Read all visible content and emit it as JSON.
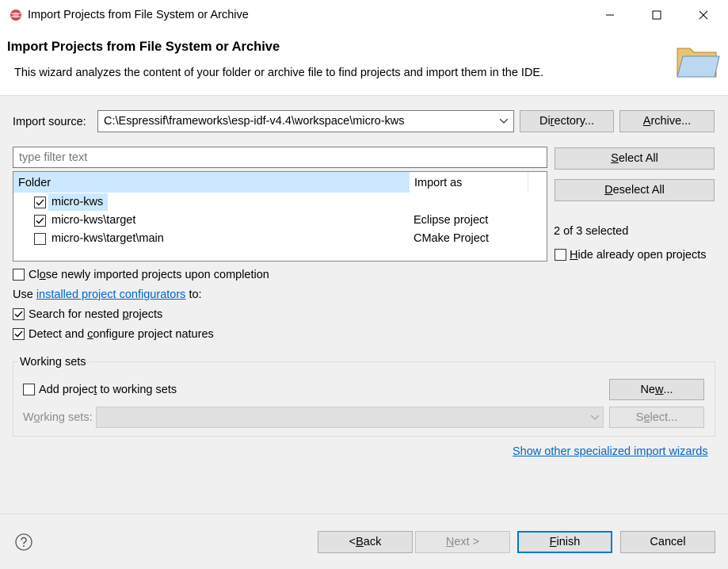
{
  "window": {
    "title": "Import Projects from File System or Archive"
  },
  "header": {
    "title": "Import Projects from File System or Archive",
    "description": "This wizard analyzes the content of your folder or archive file to find projects and import them in the IDE."
  },
  "import_source": {
    "label": "Import source:",
    "value": "C:\\Espressif\\frameworks\\esp-idf-v4.4\\workspace\\micro-kws",
    "directory_btn": {
      "pre": "Di",
      "u": "r",
      "post": "ectory..."
    },
    "archive_btn": {
      "pre": "",
      "u": "A",
      "post": "rchive..."
    }
  },
  "filter": {
    "placeholder": "type filter text"
  },
  "table": {
    "col_folder": "Folder",
    "col_import_as": "Import as",
    "rows": [
      {
        "folder": "micro-kws",
        "import_as": "",
        "checked": true
      },
      {
        "folder": "micro-kws\\target",
        "import_as": "Eclipse project",
        "checked": true
      },
      {
        "folder": "micro-kws\\target\\main",
        "import_as": "CMake Project",
        "checked": false
      }
    ]
  },
  "side": {
    "select_all": {
      "pre": "",
      "u": "S",
      "post": "elect All"
    },
    "deselect_all": {
      "pre": "",
      "u": "D",
      "post": "eselect All"
    },
    "selected_count": "2 of 3 selected",
    "hide_open": {
      "pre": "",
      "u": "H",
      "post": "ide already open projects"
    }
  },
  "options": {
    "close_projects": {
      "pre": "Cl",
      "u": "o",
      "post": "se newly imported projects upon completion"
    },
    "use_prefix": "Use",
    "configurators_link": "installed project configurators",
    "use_suffix": "to:",
    "search_nested": {
      "pre": "Search for nested ",
      "u": "p",
      "post": "rojects"
    },
    "detect_natures": {
      "pre": "Detect and ",
      "u": "c",
      "post": "onfigure project natures"
    }
  },
  "working_sets": {
    "group_label": "Working sets",
    "add_label": {
      "pre": "Add projec",
      "u": "t",
      "post": " to working sets"
    },
    "new_btn": {
      "pre": "Ne",
      "u": "w",
      "post": "..."
    },
    "field_label": {
      "pre": "W",
      "u": "o",
      "post": "rking sets:"
    },
    "select_btn": {
      "pre": "S",
      "u": "e",
      "post": "lect..."
    }
  },
  "specialized_link": "Show other specialized import wizards",
  "footer": {
    "back": {
      "pre": "< ",
      "u": "B",
      "post": "ack"
    },
    "next": {
      "pre": "",
      "u": "N",
      "post": "ext >"
    },
    "finish": {
      "pre": "",
      "u": "F",
      "post": "inish"
    },
    "cancel": "Cancel"
  },
  "colors": {
    "accent": "#0078d7",
    "selection": "#cce8ff",
    "link": "#0066cc"
  }
}
